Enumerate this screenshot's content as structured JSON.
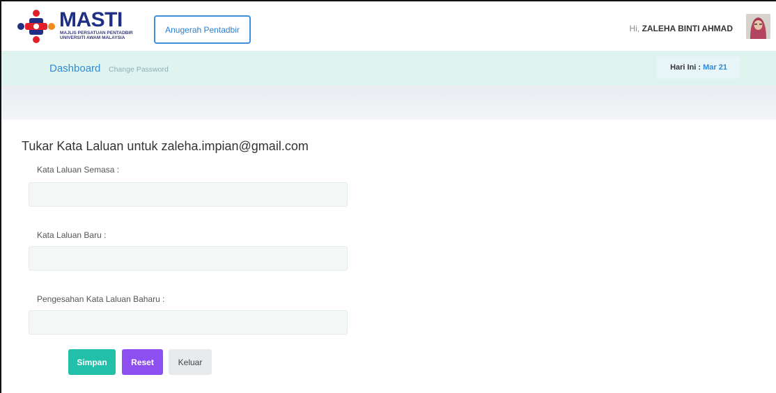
{
  "header": {
    "logo": {
      "title": "MASTI",
      "subtitle_line1": "MAJLIS PERSATUAN PENTADBIR",
      "subtitle_line2": "UNIVERSITI AWAM MALAYSIA",
      "icon": "masti-logo-icon",
      "colors": {
        "red": "#e0202a",
        "blue": "#1f2f86",
        "orange": "#f08a1c"
      }
    },
    "award_button_label": "Anugerah Pentadbir",
    "greeting_prefix": "Hi,",
    "user_name": "ZALEHA BINTI AHMAD",
    "avatar_icon": "user-avatar"
  },
  "nav": {
    "dashboard_label": "Dashboard",
    "change_password_label": "Change Password",
    "date_label": "Hari Ini :",
    "date_value": "Mar 21"
  },
  "form": {
    "title": "Tukar Kata Laluan untuk zaleha.impian@gmail.com",
    "current_password": {
      "label": "Kata Laluan Semasa :",
      "value": "",
      "placeholder": ""
    },
    "new_password": {
      "label": "Kata Laluan Baru :",
      "value": "",
      "placeholder": ""
    },
    "confirm_password": {
      "label": "Pengesahan Kata Laluan Baharu :",
      "value": "",
      "placeholder": ""
    },
    "buttons": {
      "save": "Simpan",
      "reset": "Reset",
      "exit": "Keluar"
    }
  },
  "colors": {
    "accent_blue": "#2f8ad8",
    "nav_bg": "#dff4ef",
    "save_button": "#22bfa9",
    "reset_button": "#8e4ff0",
    "exit_button": "#e7ebee"
  }
}
